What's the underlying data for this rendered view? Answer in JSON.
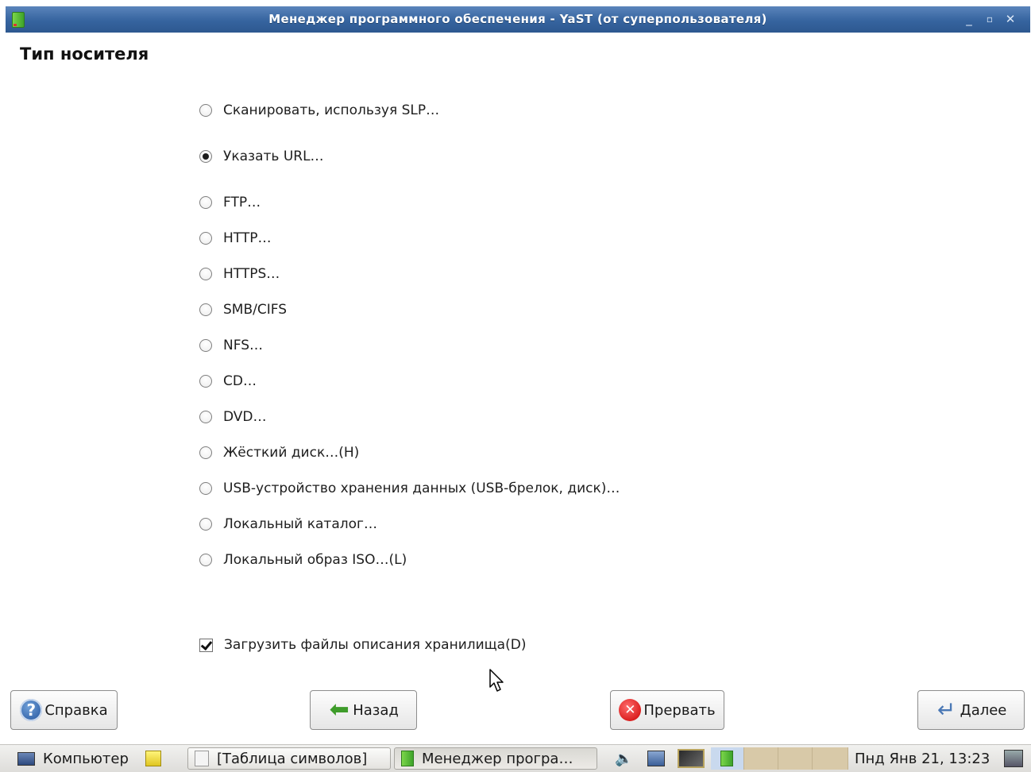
{
  "window": {
    "title": "Менеджер программного обеспечения - YaST (от суперпользователя)",
    "controls": {
      "minimize": "_",
      "maximize": "▫",
      "close": "✕"
    }
  },
  "heading": "Тип носителя",
  "options": [
    {
      "label": "Сканировать, используя SLP…",
      "selected": false
    },
    {
      "label": "Указать URL…",
      "selected": true
    },
    {
      "label": "FTP…",
      "selected": false
    },
    {
      "label": "HTTP…",
      "selected": false
    },
    {
      "label": "HTTPS…",
      "selected": false
    },
    {
      "label": "SMB/CIFS",
      "selected": false
    },
    {
      "label": "NFS…",
      "selected": false
    },
    {
      "label": "CD…",
      "selected": false
    },
    {
      "label": "DVD…",
      "selected": false
    },
    {
      "label": "Жёсткий диск…(H)",
      "selected": false
    },
    {
      "label": "USB-устройство хранения данных (USB-брелок, диск)…",
      "selected": false
    },
    {
      "label": "Локальный каталог…",
      "selected": false
    },
    {
      "label": "Локальный образ ISO…(L)",
      "selected": false
    }
  ],
  "checkbox": {
    "label": "Загрузить файлы описания хранилища(D)",
    "checked": true
  },
  "buttons": {
    "help": "Справка",
    "back": "Назад",
    "abort": "Прервать",
    "next": "Далее"
  },
  "taskbar": {
    "computer": "Компьютер",
    "tasks": [
      "[Таблица символов]",
      "Менеджер програ…"
    ],
    "clock": "Пнд Янв 21, 13:23"
  },
  "colors": {
    "titlebar": "#36649f",
    "accent_green": "#3e9c2a",
    "stop_red": "#cc0000"
  }
}
